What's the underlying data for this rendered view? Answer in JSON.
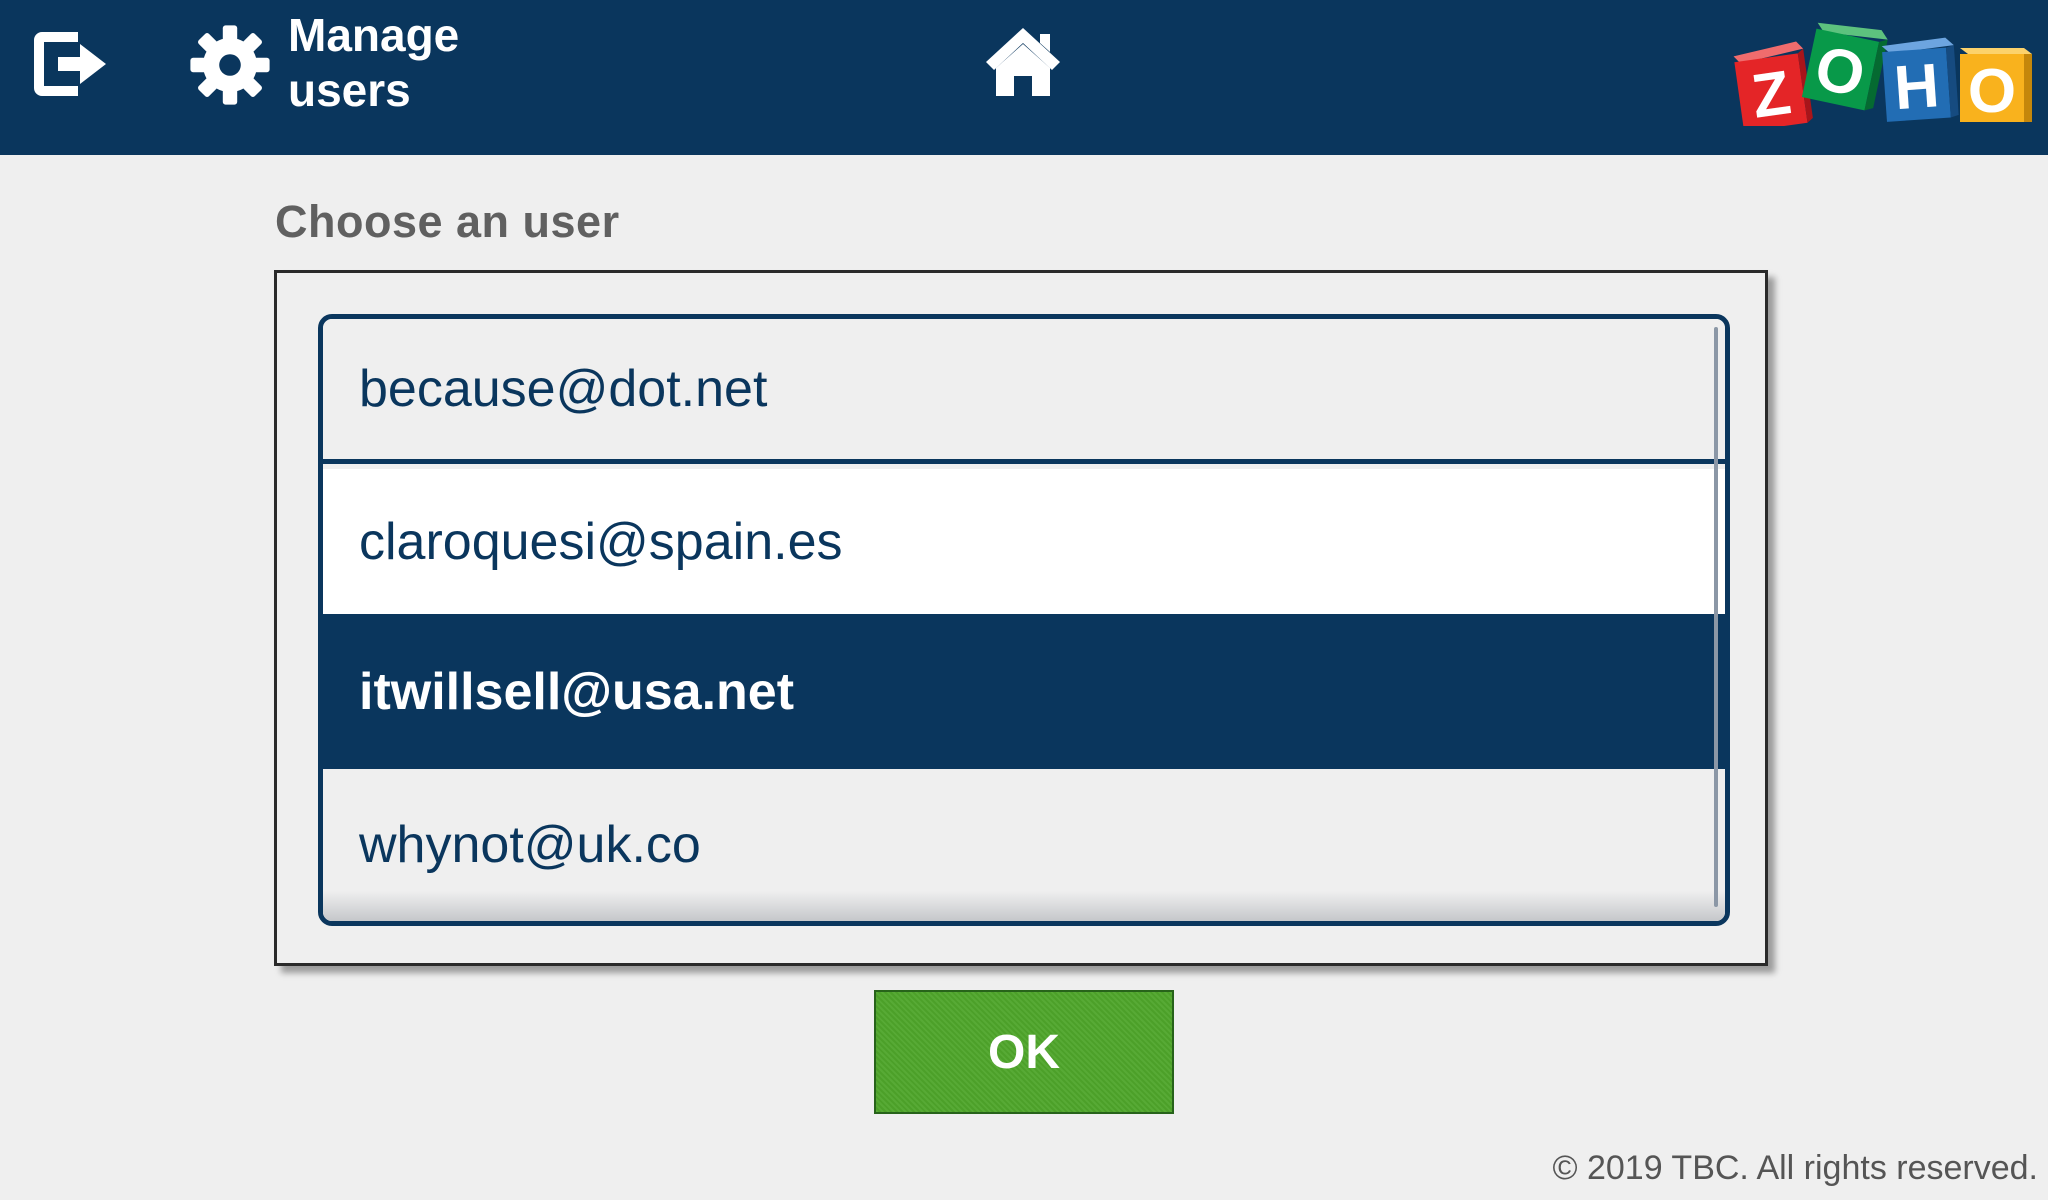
{
  "header": {
    "title_line1": "Manage",
    "title_line2": "users",
    "exit_icon": "exit-icon",
    "settings_icon": "gear-icon",
    "home_icon": "home-icon",
    "logo": {
      "letters": [
        "Z",
        "O",
        "H",
        "O"
      ],
      "colors": [
        "#e42527",
        "#089949",
        "#226db4",
        "#f9b21d"
      ]
    },
    "background_color": "#0a365d"
  },
  "main": {
    "label": "Choose an user",
    "users": [
      {
        "email": "because@dot.net",
        "selected": false
      },
      {
        "email": "claroquesi@spain.es",
        "selected": false
      },
      {
        "email": "itwillsell@usa.net",
        "selected": true
      },
      {
        "email": "whynot@uk.co",
        "selected": false
      }
    ],
    "ok_label": "OK",
    "ok_color": "#4ea52a"
  },
  "footer": {
    "copyright": "© 2019 TBC. All rights reserved."
  }
}
